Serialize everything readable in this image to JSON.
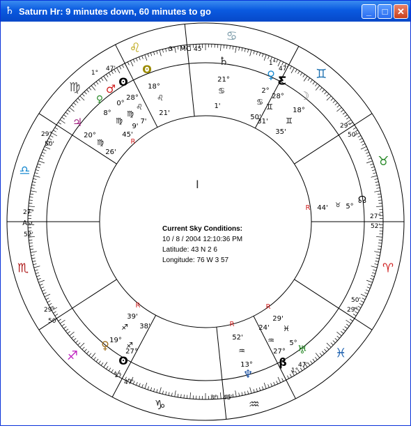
{
  "window": {
    "title": "Saturn Hr: 9 minutes down, 60 minutes to go",
    "title_icon": "♄",
    "buttons": {
      "minimize": "_",
      "maximize": "□",
      "close": "✕"
    }
  },
  "info": {
    "heading": "Current Sky Conditions:",
    "datetime": "10 / 8 / 2004   12:10:36 PM",
    "latitude": "Latitude:  43 N 2 6",
    "longitude": "Longitude:  76 W 3 57"
  },
  "zodiac_signs": [
    {
      "glyph": "♌",
      "color": "#b8a000",
      "name": "leo"
    },
    {
      "glyph": "♋",
      "color": "#7a9aa8",
      "name": "cancer"
    },
    {
      "glyph": "♊",
      "color": "#1a6fb0",
      "name": "gemini"
    },
    {
      "glyph": "♉",
      "color": "#2a8a2a",
      "name": "taurus"
    },
    {
      "glyph": "♈",
      "color": "#d02020",
      "name": "aries"
    },
    {
      "glyph": "♓",
      "color": "#1a5faf",
      "name": "pisces"
    },
    {
      "glyph": "♒",
      "color": "#333333",
      "name": "aquarius"
    },
    {
      "glyph": "♑",
      "color": "#222222",
      "name": "capricorn"
    },
    {
      "glyph": "♐",
      "color": "#c020c0",
      "name": "sagittarius"
    },
    {
      "glyph": "♏",
      "color": "#b02020",
      "name": "scorpio"
    },
    {
      "glyph": "♎",
      "color": "#1a8ad0",
      "name": "libra"
    },
    {
      "glyph": "♍",
      "color": "#555555",
      "name": "virgo"
    }
  ],
  "angles": {
    "mc_label": "MC",
    "asc_label": "Asc"
  },
  "labels": [
    {
      "t": "3°"
    },
    {
      "t": "45'"
    },
    {
      "t": "1°"
    },
    {
      "t": "47'"
    },
    {
      "t": "29°"
    },
    {
      "t": "50'"
    },
    {
      "t": "27°"
    },
    {
      "t": "52'"
    },
    {
      "t": "50'"
    },
    {
      "t": "29°"
    },
    {
      "t": "47'"
    },
    {
      "t": "1°"
    },
    {
      "t": "3°"
    },
    {
      "t": "45'"
    },
    {
      "t": "47'"
    },
    {
      "t": "1°"
    },
    {
      "t": "50'"
    },
    {
      "t": "29°"
    },
    {
      "t": "52'"
    },
    {
      "t": "27°"
    },
    {
      "t": "29°"
    },
    {
      "t": "50'"
    },
    {
      "t": "1°"
    },
    {
      "t": "47'"
    }
  ],
  "planets": [
    {
      "g": "♄",
      "c": "#222"
    },
    {
      "g": "21°",
      "c": "#000"
    },
    {
      "g": "♋",
      "c": "#000"
    },
    {
      "g": "1'",
      "c": "#000"
    },
    {
      "g": "♀",
      "c": "#1a8ad0"
    },
    {
      "g": "Ƹ",
      "c": "#000"
    },
    {
      "g": "☽",
      "c": "#888"
    },
    {
      "g": "2°",
      "c": "#000"
    },
    {
      "g": "28°",
      "c": "#000"
    },
    {
      "g": "18°",
      "c": "#000"
    },
    {
      "g": "♋",
      "c": "#000"
    },
    {
      "g": "♊",
      "c": "#000"
    },
    {
      "g": "50'",
      "c": "#000"
    },
    {
      "g": "31'",
      "c": "#000"
    },
    {
      "g": "♊",
      "c": "#000"
    },
    {
      "g": "35'",
      "c": "#000"
    },
    {
      "g": "♂",
      "c": "#d02020"
    },
    {
      "g": "ʘ",
      "c": "#000"
    },
    {
      "g": "ʘ",
      "c": "#9a8a00"
    },
    {
      "g": "♀",
      "c": "#2a8a2a"
    },
    {
      "g": "0°",
      "c": "#000"
    },
    {
      "g": "28°",
      "c": "#000"
    },
    {
      "g": "18°",
      "c": "#000"
    },
    {
      "g": "8°",
      "c": "#000"
    },
    {
      "g": "♍",
      "c": "#000"
    },
    {
      "g": "♌",
      "c": "#000"
    },
    {
      "g": "♌",
      "c": "#000"
    },
    {
      "g": "21'",
      "c": "#000"
    },
    {
      "g": "♍",
      "c": "#000"
    },
    {
      "g": "9'",
      "c": "#000"
    },
    {
      "g": "7'",
      "c": "#000"
    },
    {
      "g": "♃",
      "c": "#a02080"
    },
    {
      "g": "20°",
      "c": "#000"
    },
    {
      "g": "45'",
      "c": "#000"
    },
    {
      "g": "♍",
      "c": "#000"
    },
    {
      "g": "R",
      "c": "#d02020"
    },
    {
      "g": "26'",
      "c": "#000"
    },
    {
      "g": "R",
      "c": "#d02020"
    },
    {
      "g": "44'",
      "c": "#000"
    },
    {
      "g": "♉",
      "c": "#000"
    },
    {
      "g": "5°",
      "c": "#000"
    },
    {
      "g": "☊",
      "c": "#000"
    },
    {
      "g": "R",
      "c": "#d02020"
    },
    {
      "g": "39'",
      "c": "#000"
    },
    {
      "g": "♐",
      "c": "#000"
    },
    {
      "g": "38'",
      "c": "#000"
    },
    {
      "g": "19°",
      "c": "#000"
    },
    {
      "g": "♐",
      "c": "#000"
    },
    {
      "g": "♀",
      "c": "#a07020"
    },
    {
      "g": "27°",
      "c": "#000"
    },
    {
      "g": "ʘ",
      "c": "#000"
    },
    {
      "g": "R",
      "c": "#d02020"
    },
    {
      "g": "29'",
      "c": "#000"
    },
    {
      "g": "R",
      "c": "#d02020"
    },
    {
      "g": "24'",
      "c": "#000"
    },
    {
      "g": "♓",
      "c": "#000"
    },
    {
      "g": "52'",
      "c": "#000"
    },
    {
      "g": "♒",
      "c": "#000"
    },
    {
      "g": "5°",
      "c": "#000"
    },
    {
      "g": "27°",
      "c": "#000"
    },
    {
      "g": "♅",
      "c": "#2a8a2a"
    },
    {
      "g": "♒",
      "c": "#000"
    },
    {
      "g": "13°",
      "c": "#000"
    },
    {
      "g": "β",
      "c": "#000"
    },
    {
      "g": "♆",
      "c": "#1a4fa0"
    }
  ]
}
